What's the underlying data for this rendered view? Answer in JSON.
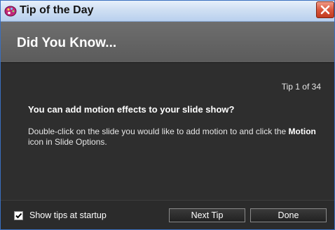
{
  "window": {
    "title": "Tip of the Day",
    "app_icon": "palette-icon",
    "close_icon": "close-icon"
  },
  "header": {
    "title": "Did You Know..."
  },
  "tip": {
    "counter": "Tip 1 of 34",
    "headline": "You can add motion effects to your slide show?",
    "body_before": "Double-click on the slide you would like to add motion to and click the ",
    "body_bold": "Motion",
    "body_after": " icon in Slide Options."
  },
  "footer": {
    "show_tips_label": "Show tips at startup",
    "show_tips_checked": true,
    "next_tip_label": "Next Tip",
    "done_label": "Done"
  },
  "colors": {
    "title_bar": "#cfdff3",
    "header": "#5f5f5f",
    "content": "#2e2e2e",
    "close_button": "#d9563c"
  }
}
